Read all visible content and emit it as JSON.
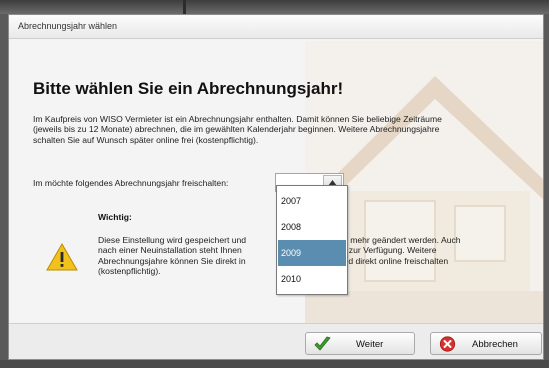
{
  "window": {
    "title": "Abrechnungsjahr wählen"
  },
  "heading": "Bitte wählen Sie ein Abrechnungsjahr!",
  "intro_lines": [
    "Im Kaufpreis von WISO Vermieter ist ein Abrechnungsjahr enthalten. Damit können Sie beliebige Zeiträume",
    "(jeweils bis zu 12 Monate) abrechnen, die im gewählten Kalenderjahr beginnen. Weitere Abrechnungsjahre",
    "schalten Sie auf Wunsch später online frei (kostenpflichtig)."
  ],
  "select": {
    "label": "Im möchte folgendes Abrechnungsjahr freischalten:",
    "value": "",
    "options": [
      "2007",
      "2008",
      "2009",
      "2010"
    ],
    "highlighted": "2009"
  },
  "warning": {
    "title": "Wichtig:",
    "lines": [
      "Diese Einstellung wird gespeichert und                                h nicht mehr geändert werden. Auch",
      "nach einer Neuinstallation steht Ihnen                            nungsjahr zur Verfügung. Weitere",
      "Abrechnungsjahre können Sie direkt in                              egen und direkt online freischalten",
      "(kostenpflichtig)."
    ],
    "icon": "warning-icon"
  },
  "buttons": {
    "next_label": "Weiter",
    "next_icon": "checkmark-icon",
    "cancel_label": "Abbrechen",
    "cancel_icon": "cancel-icon"
  },
  "colors": {
    "selection": "#5b8db0",
    "check_green": "#3f9b2e",
    "cancel_red": "#d9302b",
    "warning_yellow": "#f2c21b"
  }
}
